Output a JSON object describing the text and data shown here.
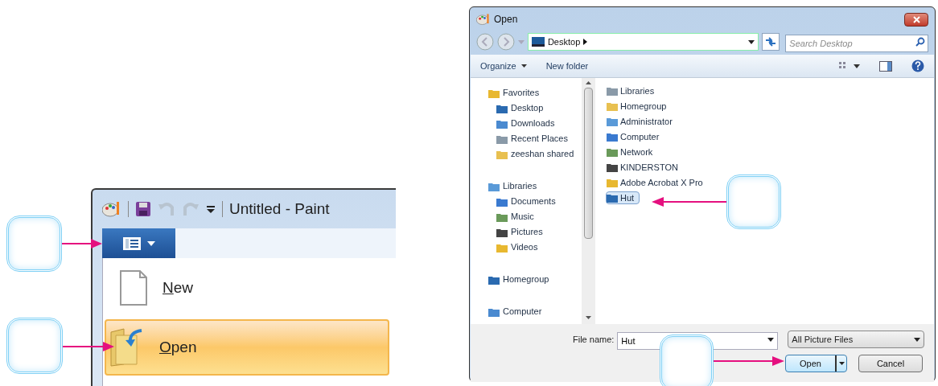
{
  "paint_window": {
    "title": "Untitled - Paint",
    "file_menu": [
      {
        "label": "New",
        "selected": false
      },
      {
        "label": "Open",
        "selected": true
      }
    ]
  },
  "open_dialog": {
    "title": "Open",
    "address": "Desktop",
    "search": {
      "placeholder": "Search Desktop"
    },
    "toolbar": [
      "Organize",
      "New folder"
    ],
    "nav_tree": [
      {
        "label": "Favorites",
        "children": [
          {
            "label": "Desktop"
          },
          {
            "label": "Downloads"
          },
          {
            "label": "Recent Places"
          },
          {
            "label": "zeeshan shared"
          }
        ]
      },
      {
        "label": "Libraries",
        "children": [
          {
            "label": "Documents"
          },
          {
            "label": "Music"
          },
          {
            "label": "Pictures"
          },
          {
            "label": "Videos"
          }
        ]
      },
      {
        "label": "Homegroup"
      },
      {
        "label": "Computer"
      }
    ],
    "files": [
      {
        "label": "Libraries",
        "selected": false
      },
      {
        "label": "Homegroup",
        "selected": false
      },
      {
        "label": "Administrator",
        "selected": false
      },
      {
        "label": "Computer",
        "selected": false
      },
      {
        "label": "Network",
        "selected": false
      },
      {
        "label": "KINDERSTON",
        "selected": false
      },
      {
        "label": "Adobe Acrobat X Pro",
        "selected": false
      },
      {
        "label": "Hut",
        "selected": true
      }
    ],
    "file_name": {
      "label": "File name:",
      "value": "Hut"
    },
    "file_type": "All Picture Files",
    "buttons": [
      "Open",
      "Cancel"
    ]
  }
}
